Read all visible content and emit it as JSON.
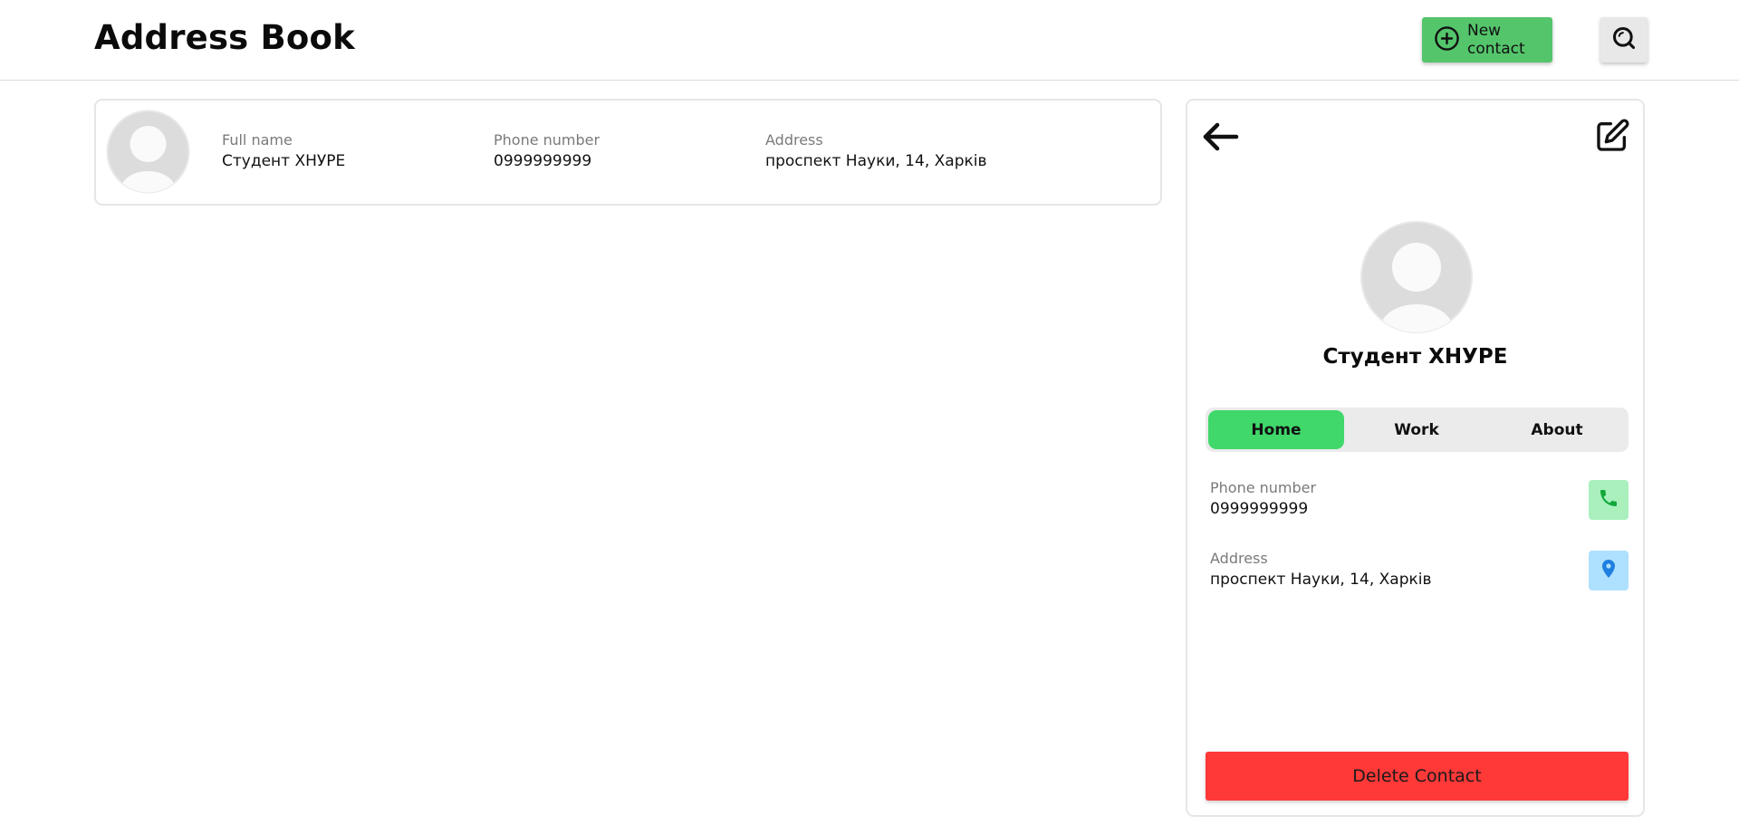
{
  "app": {
    "title": "Address Book"
  },
  "header": {
    "new_contact_label": "New contact",
    "new_contact_icon": "plus-circle-icon",
    "search_icon": "search-icon",
    "accent_color": "#54c56b"
  },
  "contact_list": [
    {
      "full_name_label": "Full name",
      "full_name": "Студент ХНУРЕ",
      "phone_label": "Phone number",
      "phone": "0999999999",
      "address_label": "Address",
      "address": "проспект Науки, 14, Харків"
    }
  ],
  "detail": {
    "back_icon": "arrow-left-icon",
    "edit_icon": "edit-icon",
    "name": "Студент ХНУРЕ",
    "tabs": [
      {
        "label": "Home",
        "active": true
      },
      {
        "label": "Work",
        "active": false
      },
      {
        "label": "About",
        "active": false
      }
    ],
    "phone_label": "Phone number",
    "phone": "0999999999",
    "phone_icon": "phone-icon",
    "address_label": "Address",
    "address": "проспект Науки, 14, Харків",
    "address_icon": "map-pin-icon",
    "delete_label": "Delete Contact",
    "tab_active_color": "#40d86a",
    "delete_color": "#ff3838"
  }
}
